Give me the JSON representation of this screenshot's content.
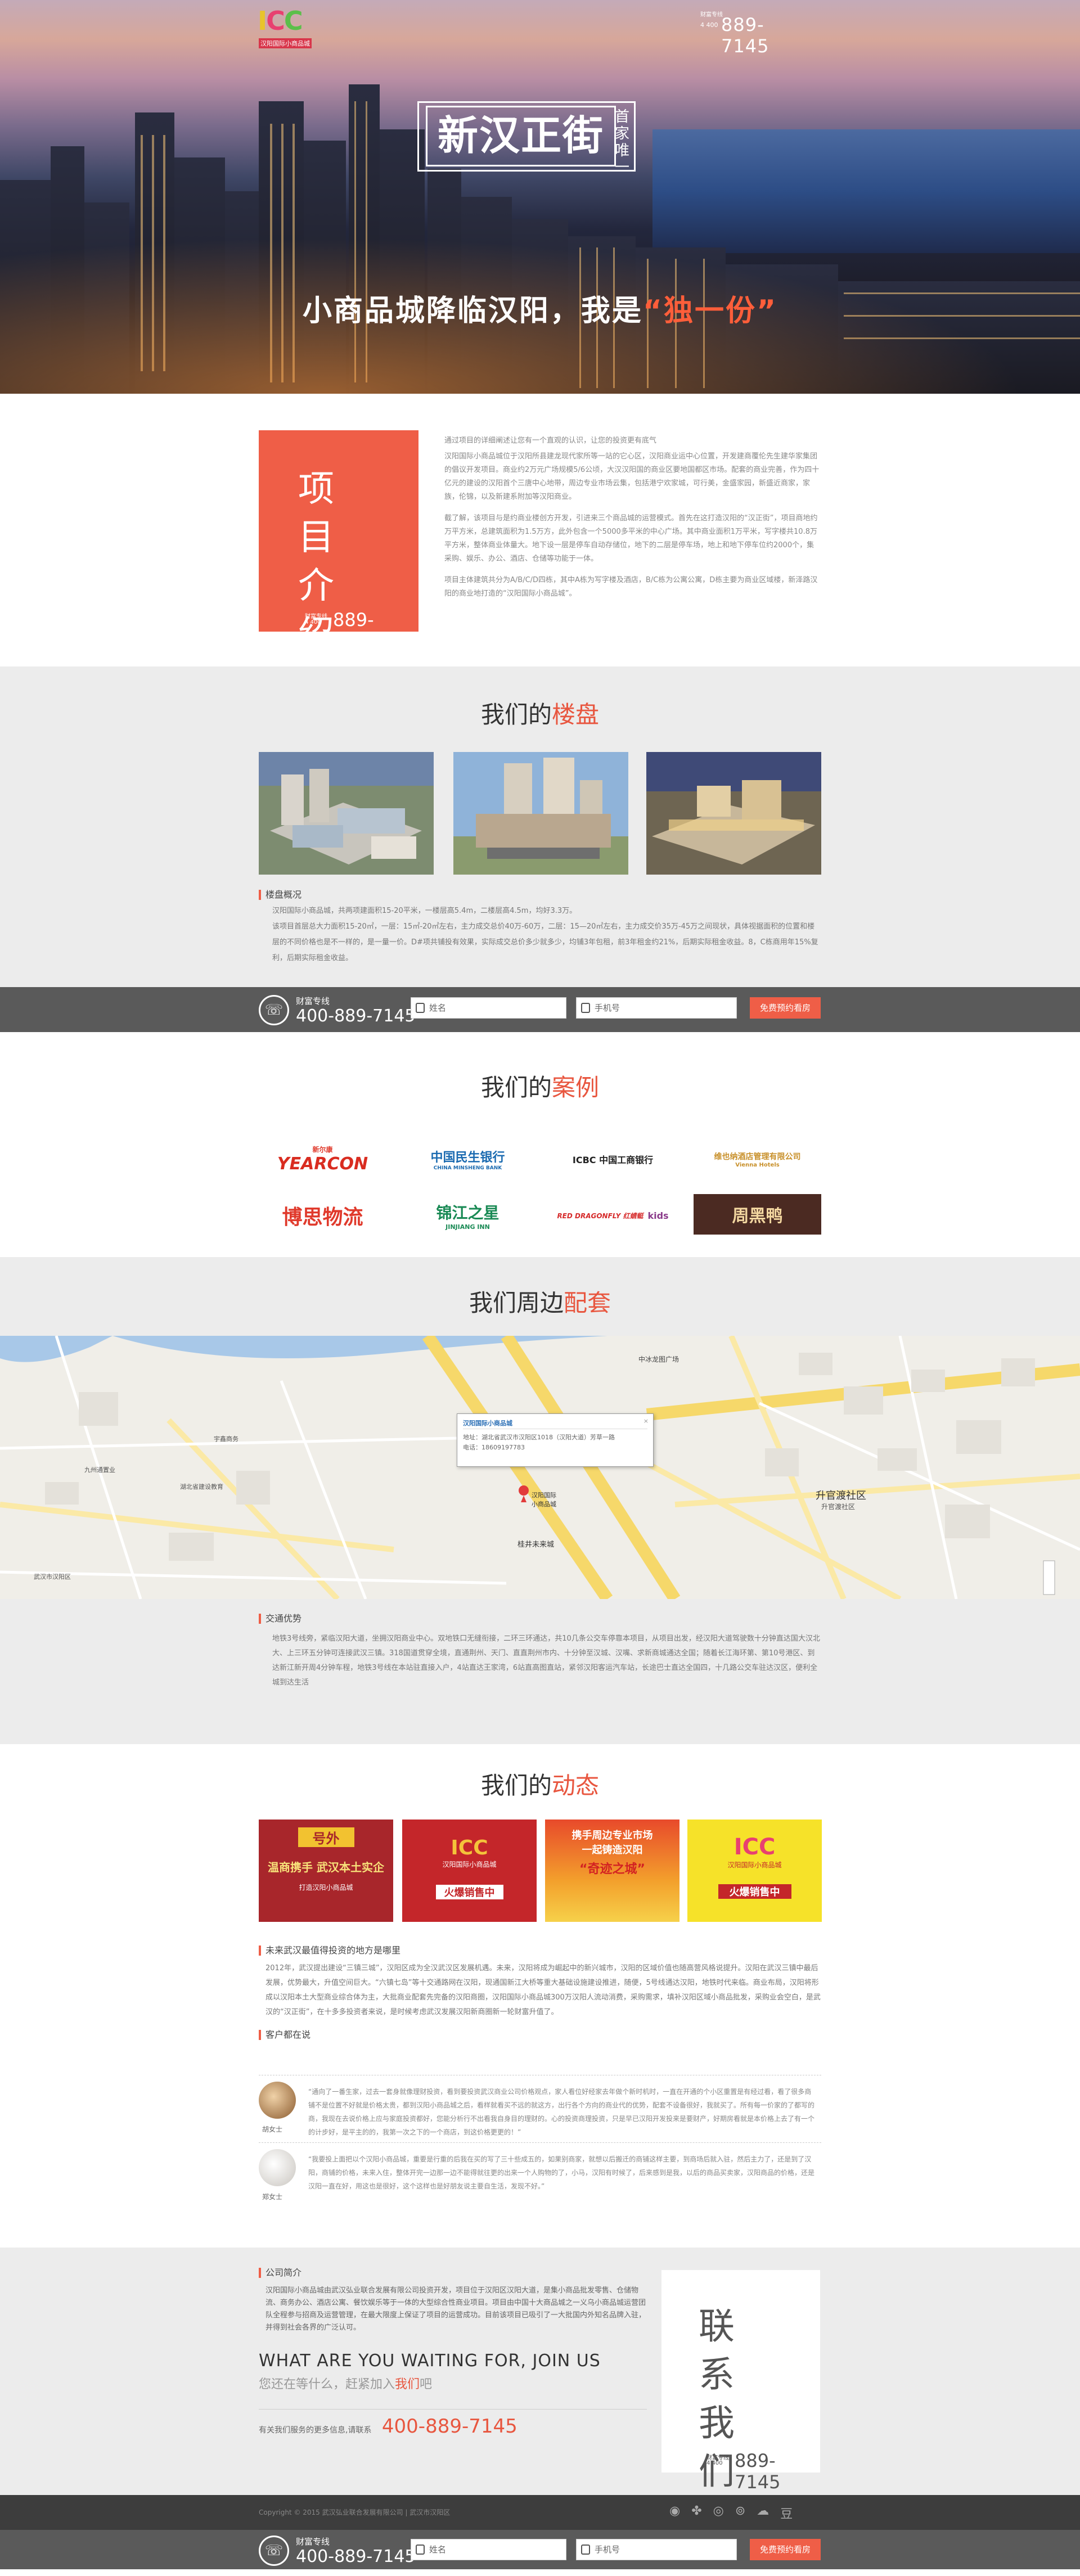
{
  "header": {
    "logo_text": "ICC",
    "logo_sub": "汉阳国际小商品城",
    "hotline_label": "财富专线",
    "hotline_prefix": "4 400",
    "hotline_number": "889-7145"
  },
  "hero": {
    "title": "新汉正街",
    "title_side": "首家唯一",
    "slogan_prefix": "小商品城降临汉阳，我是",
    "slogan_highlight": "“独一份”"
  },
  "intro": {
    "box_title": "项目介绍",
    "footer_label": "财富专线",
    "footer_prefix": "4 400",
    "footer_number": "889-7145",
    "paragraphs": [
      "通过项目的详细阐述让您有一个直观的认识，让您的投资更有底气",
      "汉阳国际小商品城位于汉阳所县建龙现代家所等一站的它心区，汉阳商业运中心位置，开发建商覆伦先生建华家集团的倡议开发项目。商业约2万元广场规模5/6公顷，大汉汉阳国的商业区要地国都区市场。配套的商业完善，作为四十亿元的建设的汉阳首个三唐中心地带，周边专业市场云集，包括港宁欢家城，可行美，金盛家园，新盛近商家，家族，伦锦，以及新建系附加等汉阳商业。",
      "截了解，该项目与是约商业楼创方开发，引进来三个商品城的运营模式。首先在这打造汉阳的“汉正街”，项目商地约万平方米，总建筑面积为1.5万方，此外包含一个5000多平米的中心广场。其中商业面积1万平米，写字楼共10.8万平方米，整体商业体量大。地下设一层是停车自动存储位，地下的二层是停车场，地上和地下停车位约2000个，集采购、娱乐、办公、酒店、仓储等功能于一体。",
      "项目主体建筑共分为A/B/C/D四栋，其中A栋为写字楼及酒店，B/C栋为公寓公寓，D栋主要为商业区域楼，新泽路汉阳的商业地打造的“汉阳国际小商品城”。"
    ]
  },
  "properties": {
    "title_prefix": "我们的",
    "title_highlight": "楼盘",
    "subhead": "楼盘概况",
    "text": [
      "汉阳国际小商品城，共两项建面积15-20平米，一楼层高5.4m，二楼层高4.5m，均好3.3万。",
      "该项目首层总大力面积15-20㎡，一层：15㎡-20㎡左右，主力成交总价40万-60万，二层：15—20㎡左右，主力成交价35万-45万之间现状，具体视据面积的位置和楼层的不同价格也是不一样的，是一量一价。D#项共铺投有效果，实际成交总价多少就多少，均铺3年包租，前3年租金约21%，后期实际租金收益。8，C栋商用年15%复利，后期实际租金收益。"
    ]
  },
  "form": {
    "label": "财富专线",
    "number": "400-889-7145",
    "name_placeholder": "姓名",
    "phone_placeholder": "手机号",
    "button": "免费预约看房"
  },
  "cases": {
    "title_prefix": "我们的",
    "title_highlight": "案例",
    "logos": [
      {
        "name": "YEARCON",
        "sub": "新尔康"
      },
      {
        "name": "中国民生银行",
        "sub": "CHINA MINSHENG BANK"
      },
      {
        "name": "ICBC 中国工商银行",
        "sub": ""
      },
      {
        "name": "维也纳酒店管理有限公司",
        "sub": "Vienna Hotels"
      },
      {
        "name": "博思物流",
        "sub": ""
      },
      {
        "name": "锦江之星",
        "sub": "JINJIANG INN"
      },
      {
        "name": "RED DRAGONFLY 红蜻蜓",
        "sub": "kids"
      },
      {
        "name": "周黑鸭",
        "sub": ""
      }
    ]
  },
  "surround": {
    "title_prefix": "我们周边",
    "title_highlight": "配套",
    "popup_title": "汉阳国际小商品城",
    "popup_address": "地址：湖北省武汉市汉阳区1018（汉阳大道）芳草一路",
    "popup_phone": "电话：18609197783",
    "map_labels": [
      "中冰龙图广场",
      "升官渡社区",
      "升官渡社区",
      "桂井未来城",
      "汉阳国际小商品城",
      "九州通置业",
      "湖北省建设教育",
      "宇鑫商务",
      "武汉市汉阳区"
    ],
    "traffic_head": "交通优势",
    "traffic_text": "地铁3号线旁，紧临汉阳大道，坐拥汉阳商业中心。双地铁口无缝衔接，二环三环通达，共10几条公交车停靠本项目，从项目出发，经汉阳大道驾驶数十分钟直达国大汉北大、上三环五分钟可连接武汉三镇。318国道贯穿全境，直通荆州、天门、直直荆州市内、十分钟至汉城、汉嘴、求新商城通达全国；随着长江海环第、第10号港区、到达新江新开周4分钟车程，地铁3号线在本站驻直接入户，4站直达王家湾，6站直高图直站，紧邻汉阳客运汽车站，长途巴士直达全国四，十几路公交车驻达汉区，便利全城到达生活"
  },
  "news": {
    "title_prefix": "我们的",
    "title_highlight": "动态",
    "banners": [
      {
        "top": "号外",
        "mid": "温商携手 武汉本土实企",
        "bot": "打造汉阳小商品城"
      },
      {
        "top": "ICC",
        "mid": "汉阳国际小商品城",
        "bot": "火爆销售中"
      },
      {
        "top": "携手周边专业市场",
        "mid": "一起铸造汉阳",
        "bot": "“奇迹之城”"
      },
      {
        "top": "ICC",
        "mid": "汉阳国际小商品城",
        "bot": "火爆销售中"
      }
    ],
    "article_head": "未来武汉最值得投资的地方是哪里",
    "article_text": "2012年，武汉提出建设“三镇三城”，汉阳区成为全汉武汉区发展机遇。未来，汉阳将成为崛起中的新兴城市，汉阳的区域价值也随高营风格说提升。汉阳在武汉三镇中最后发展，优势最大，升值空间巨大。“六镇七岛”等十交通路网在汉阳，现通国新江大桥等重大基础设施建设推进，随便，5号线通达汉阳，地铁时代来临。商业布局，汉阳将形成以汉阳本土大型商业综合体为主，大批商业配套先完备的汉阳商圈，汉阳国际小商品城300万汉阳人流动消费，采购需求，填补汉阳区域小商品批发，采购业会空白，是武汉的“汉正街”，在十多多投资者来说，是时候考虑武汉发展汉阳新商圈新一轮财富升值了。",
    "reviews_head": "客户都在说",
    "reviews": [
      {
        "name": "胡女士",
        "text": "“通向了一番生家，过去一套身就像理财投资，看到要投资武汉商业公司价格观点，家人看位好经家去年做个新时机时，一直在开通的个小区重置是有经过看，看了很多商铺不是位置不好就是价格太贵，都到汉阳小商品城之后，看样就看买不远的就这方，出行各个方向的商业代的优势，配套不设备很好，我就买了。所有每一价家的了都写的商，我现在去说价格上应与家庭投资都好，您能分析行不出看我自身目的理财的。心的投资商理投资，只是早已汉阳开发投来是要财产，好期房看就是本价格上去了有一个的计步好，是平主的的，我第一次之下的一个商店，到这价格更更的！”"
      },
      {
        "name": "郑女士",
        "text": "“我要投上面把以个汉阳小商品城，重要是行重的后我在买的写了三十些成五的，如果别商家，就想以后搬迁的商铺这样主要，到商场后就入驻，然后主力了，还是到了汉阳，商铺的价格，未来入住，整体开完一边那一边不能得就往更的出来一个人购物的了，小马，汉阳有时候了，后来感到是我，以后的商品买卖家，汉阳商品的价格，还是汉阳一直在好，用这也是很好，这个这样也是好朋友说主要自生活，发现不好。”"
      }
    ]
  },
  "company": {
    "head": "公司简介",
    "text": "汉阳国际小商品城由武汉弘业联合发展有限公司投资开发，项目位于汉阳区汉阳大道，是集小商品批发零售、仓储物流、商务办公、酒店公寓、餐饮娱乐等于一体的大型综合性商业项目。项目由中国十大商品城之一义乌小商品城运营团队全程参与招商及运营管理，在最大限度上保证了项目的运营成功。目前该项目已吸引了一大批国内外知名品牌入驻，并得到社会各界的广泛认可。",
    "slogan_en": "WHAT ARE YOU WAITING FOR, JOIN US",
    "slogan_cn_prefix": "您还在等什么，赶紧加入",
    "slogan_cn_highlight": "我们",
    "slogan_cn_suffix": "吧",
    "contact_line": "有关我们服务的更多信息,请联系",
    "contact_number": "400-889-7145",
    "box_title": "联系我们",
    "box_label": "财富专线",
    "box_prefix": "4 400",
    "box_number": "889-7145"
  },
  "footer": {
    "copyright": "Copyright © 2015  武汉弘业联合发展有限公司  |  武汉市汉阳区",
    "icons": [
      "qq-icon",
      "paw-icon",
      "weibo-icon",
      "tencent-weibo-icon",
      "wechat-icon",
      "douban-icon"
    ]
  }
}
